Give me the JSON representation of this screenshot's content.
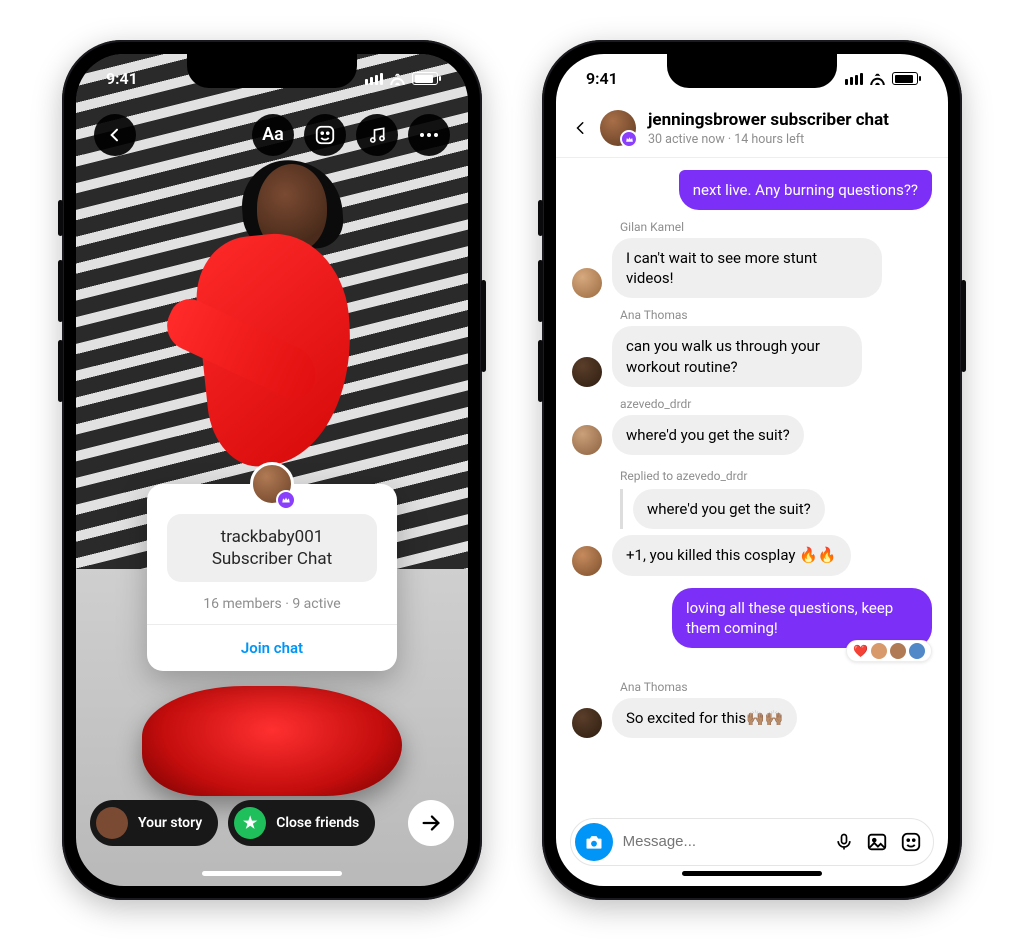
{
  "status": {
    "time": "9:41"
  },
  "story": {
    "tools": {
      "text": "Aa"
    },
    "card": {
      "title_line1": "trackbaby001",
      "title_line2": "Subscriber Chat",
      "subtitle": "16 members · 9 active",
      "action": "Join chat"
    },
    "footer": {
      "your_story": "Your story",
      "close_friends": "Close friends"
    }
  },
  "chat": {
    "header": {
      "title": "jenningsbrower subscriber chat",
      "subtitle": "30 active now · 14 hours left"
    },
    "messages": {
      "m0": "next live. Any burning questions??",
      "s1": "Gilan Kamel",
      "m1": "I can't wait to see more stunt videos!",
      "s2": "Ana Thomas",
      "m2": "can you walk us through your workout routine?",
      "s3": "azevedo_drdr",
      "m3": "where'd you get the suit?",
      "reply_label": "Replied to azevedo_drdr",
      "reply_quote": "where'd you get the suit?",
      "m4": "+1, you killed this cosplay 🔥🔥",
      "m5": "loving all these questions, keep them coming!",
      "s6": "Ana Thomas",
      "m6": "So excited for this🙌🏽🙌🏽"
    },
    "composer": {
      "placeholder": "Message..."
    }
  }
}
